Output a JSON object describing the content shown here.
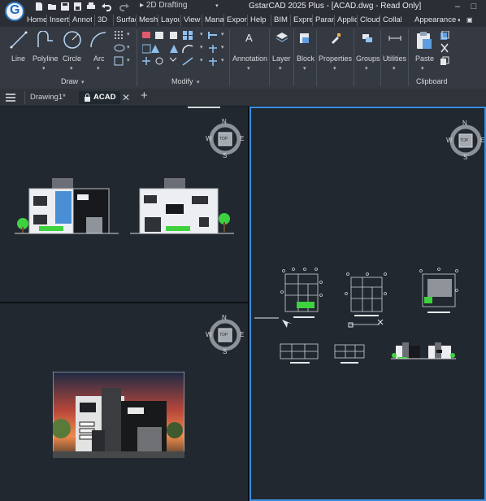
{
  "title_bar": {
    "title": "GstarCAD 2025 Plus - [ACAD.dwg - Read Only]",
    "workspace": "2D Drafting"
  },
  "ribbon_tabs": [
    "Home",
    "Insert",
    "Annot",
    "3D",
    "Surfac",
    "Mesh",
    "Layou",
    "View",
    "Mana",
    "Expor",
    "Help",
    "BIM",
    "Expre",
    "Param",
    "Applic",
    "Cloud",
    "Collab",
    "Appearance"
  ],
  "panels": {
    "draw": {
      "label": "Draw",
      "tools": [
        "Line",
        "Polyline",
        "Circle",
        "Arc"
      ]
    },
    "modify": {
      "label": "Modify"
    },
    "annotation": "Annotation",
    "layer": "Layer",
    "block": "Block",
    "properties": "Properties",
    "groups": "Groups",
    "utilities": "Utilities",
    "clipboard": {
      "label": "Clipboard",
      "paste": "Paste"
    }
  },
  "doc_tabs": {
    "drawing1": "Drawing1*",
    "acad": "ACAD"
  },
  "viewcube": {
    "n": "N",
    "s": "S",
    "e": "E",
    "w": "W",
    "top": "TOP"
  },
  "colors": {
    "accent": "#3e8ee0",
    "canvas": "#212830",
    "ribbon": "#353a42",
    "titlebar": "#2b2f35"
  }
}
